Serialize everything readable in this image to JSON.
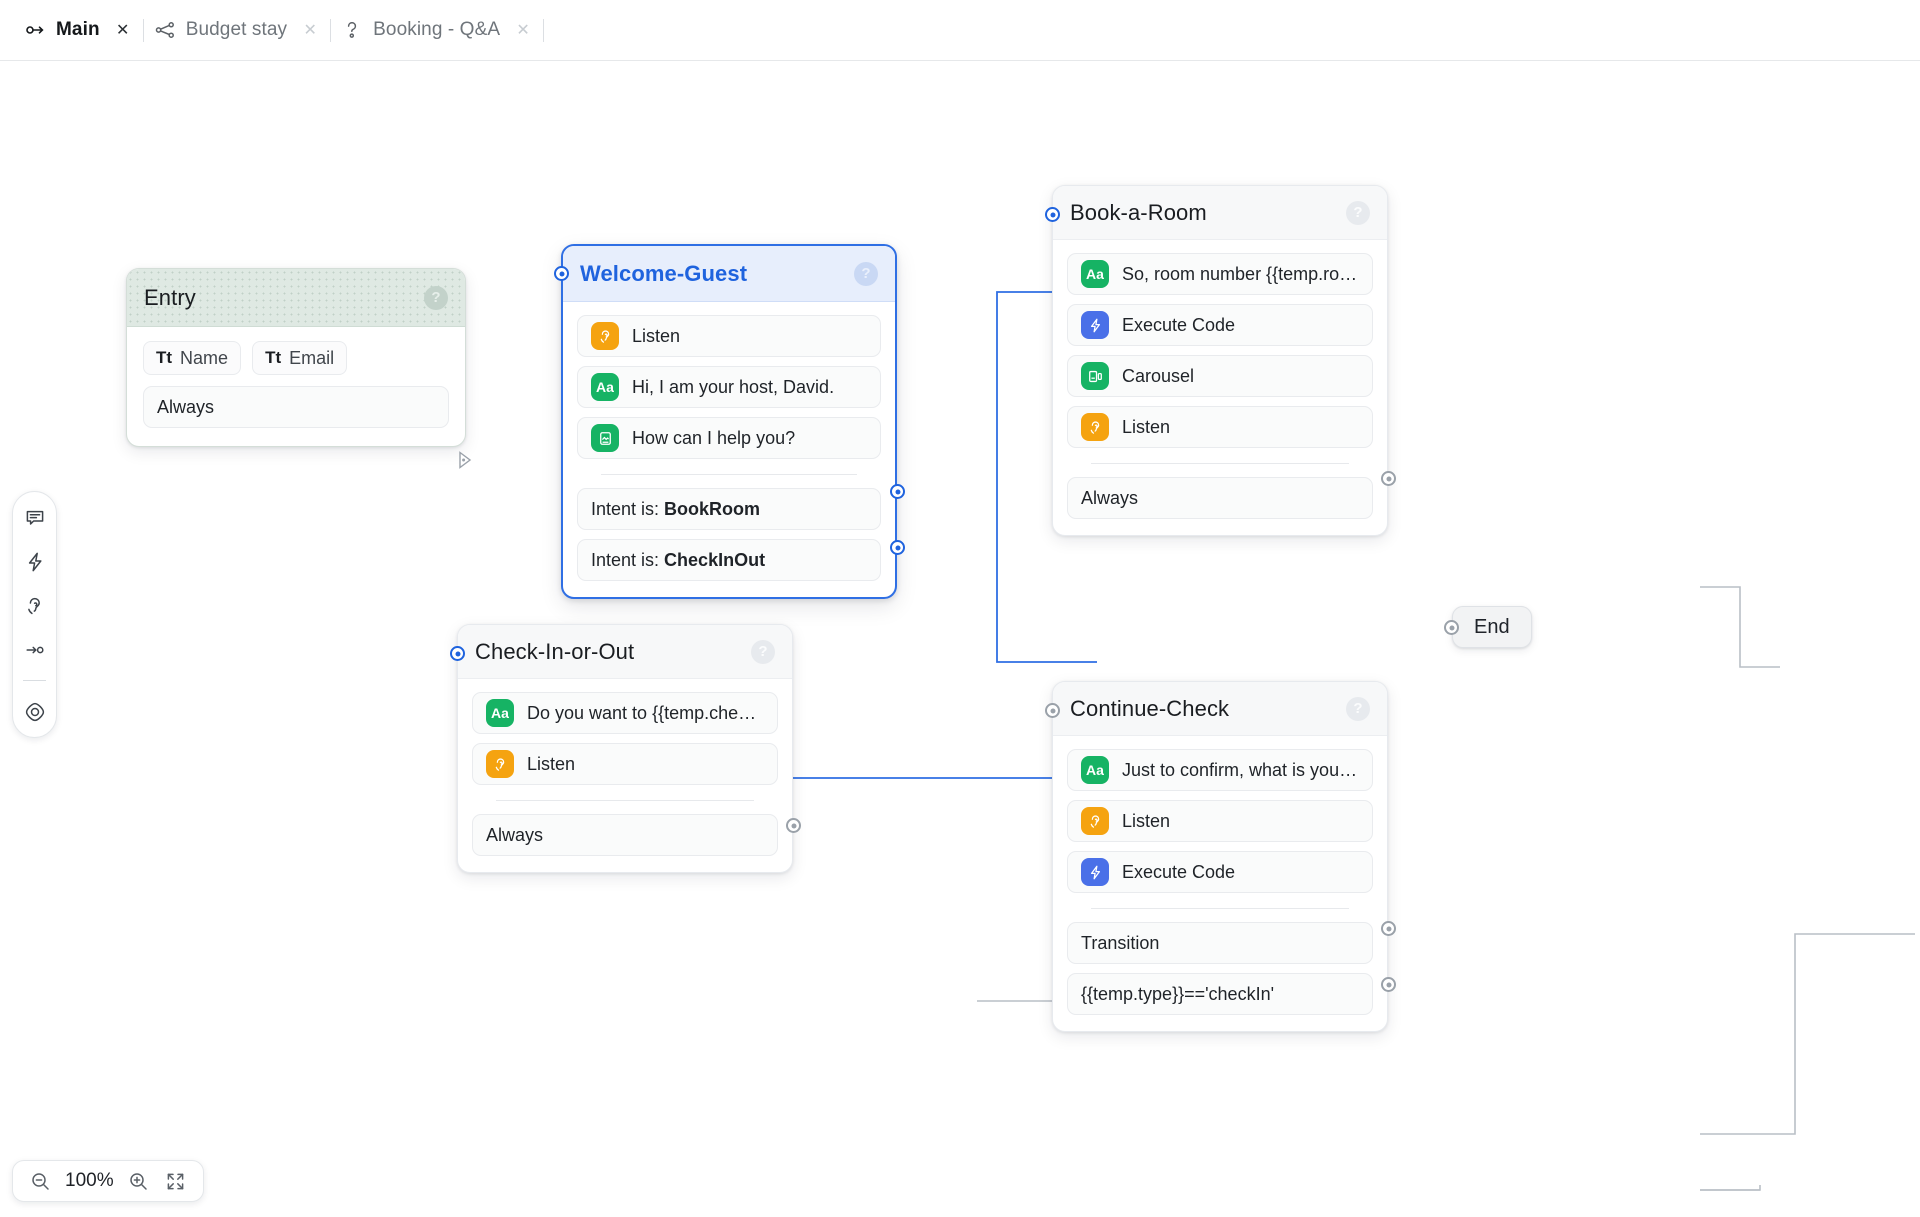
{
  "tabs": [
    {
      "label": "Main",
      "icon": "flow-start-icon",
      "active": true,
      "close": "✕"
    },
    {
      "label": "Budget stay",
      "icon": "flow-branch-icon",
      "active": false,
      "close": "✕"
    },
    {
      "label": "Booking - Q&A",
      "icon": "question-flow-icon",
      "active": false,
      "close": "✕"
    }
  ],
  "nodes": {
    "entry": {
      "title": "Entry",
      "help": "?",
      "chips": [
        {
          "prefix": "Tt",
          "label": "Name"
        },
        {
          "prefix": "Tt",
          "label": "Email"
        }
      ],
      "transition": "Always"
    },
    "welcome": {
      "title": "Welcome-Guest",
      "help": "?",
      "steps": [
        {
          "icon": "listen-icon",
          "color": "orange",
          "glyph": "ear",
          "label": "Listen"
        },
        {
          "icon": "text-message-icon",
          "color": "green",
          "glyph": "Aa",
          "label": "Hi, I am your host, David."
        },
        {
          "icon": "card-message-icon",
          "color": "green",
          "glyph": "card",
          "label": "How can I help you?"
        }
      ],
      "transitions": [
        {
          "prefix": "Intent is: ",
          "value": "BookRoom"
        },
        {
          "prefix": "Intent is: ",
          "value": "CheckInOut"
        }
      ]
    },
    "bookaroom": {
      "title": "Book-a-Room",
      "help": "?",
      "steps": [
        {
          "icon": "text-message-icon",
          "color": "green",
          "glyph": "Aa",
          "label": "So, room number {{temp.roomNu…"
        },
        {
          "icon": "execute-code-icon",
          "color": "blue",
          "glyph": "bolt",
          "label": "Execute Code"
        },
        {
          "icon": "carousel-icon",
          "color": "green",
          "glyph": "carousel",
          "label": "Carousel"
        },
        {
          "icon": "listen-icon",
          "color": "orange",
          "glyph": "ear",
          "label": "Listen"
        }
      ],
      "transition": "Always"
    },
    "checkinout": {
      "title": "Check-In-or-Out",
      "help": "?",
      "steps": [
        {
          "icon": "text-message-icon",
          "color": "green",
          "glyph": "Aa",
          "label": "Do you want to {{temp.checkIn}}?"
        },
        {
          "icon": "listen-icon",
          "color": "orange",
          "glyph": "ear",
          "label": "Listen"
        }
      ],
      "transition": "Always"
    },
    "continuecheck": {
      "title": "Continue-Check",
      "help": "?",
      "steps": [
        {
          "icon": "text-message-icon",
          "color": "green",
          "glyph": "Aa",
          "label": "Just to confirm, what is your last…"
        },
        {
          "icon": "listen-icon",
          "color": "orange",
          "glyph": "ear",
          "label": "Listen"
        },
        {
          "icon": "execute-code-icon",
          "color": "blue",
          "glyph": "bolt",
          "label": "Execute Code"
        }
      ],
      "transitions": [
        {
          "value": "Transition"
        },
        {
          "value": "{{temp.type}}=='checkIn'"
        }
      ]
    },
    "end": {
      "label": "End"
    }
  },
  "toolbar": {
    "items": [
      {
        "name": "message-icon"
      },
      {
        "name": "bolt-icon"
      },
      {
        "name": "listen-ear-icon"
      },
      {
        "name": "transition-arrow-icon"
      },
      {
        "name": "target-icon"
      }
    ]
  },
  "zoom": {
    "level": "100%",
    "out": "zoom-out-icon",
    "in": "zoom-in-icon",
    "fit": "fit-screen-icon"
  }
}
